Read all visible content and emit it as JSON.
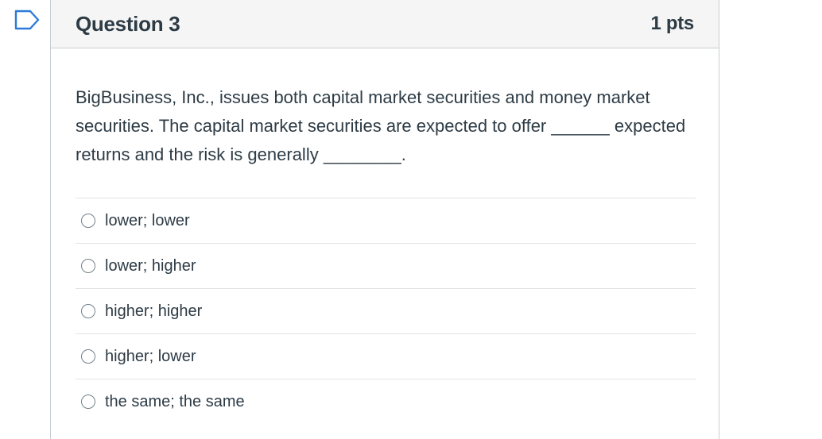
{
  "question": {
    "title": "Question 3",
    "points": "1 pts",
    "text": "BigBusiness, Inc., issues both capital market securities and money market securities.  The capital market securities are expected to offer ______ expected returns and the risk is generally ________.",
    "answers": [
      {
        "label": "lower; lower"
      },
      {
        "label": "lower; higher"
      },
      {
        "label": "higher; higher"
      },
      {
        "label": "higher; lower"
      },
      {
        "label": "the same; the same"
      }
    ]
  },
  "colors": {
    "accent": "#2d7bd8",
    "text": "#2d3b45",
    "header_bg": "#f5f5f5",
    "border": "#c7cdd1"
  },
  "icons": {
    "flag": "bookmark-flag-icon"
  }
}
